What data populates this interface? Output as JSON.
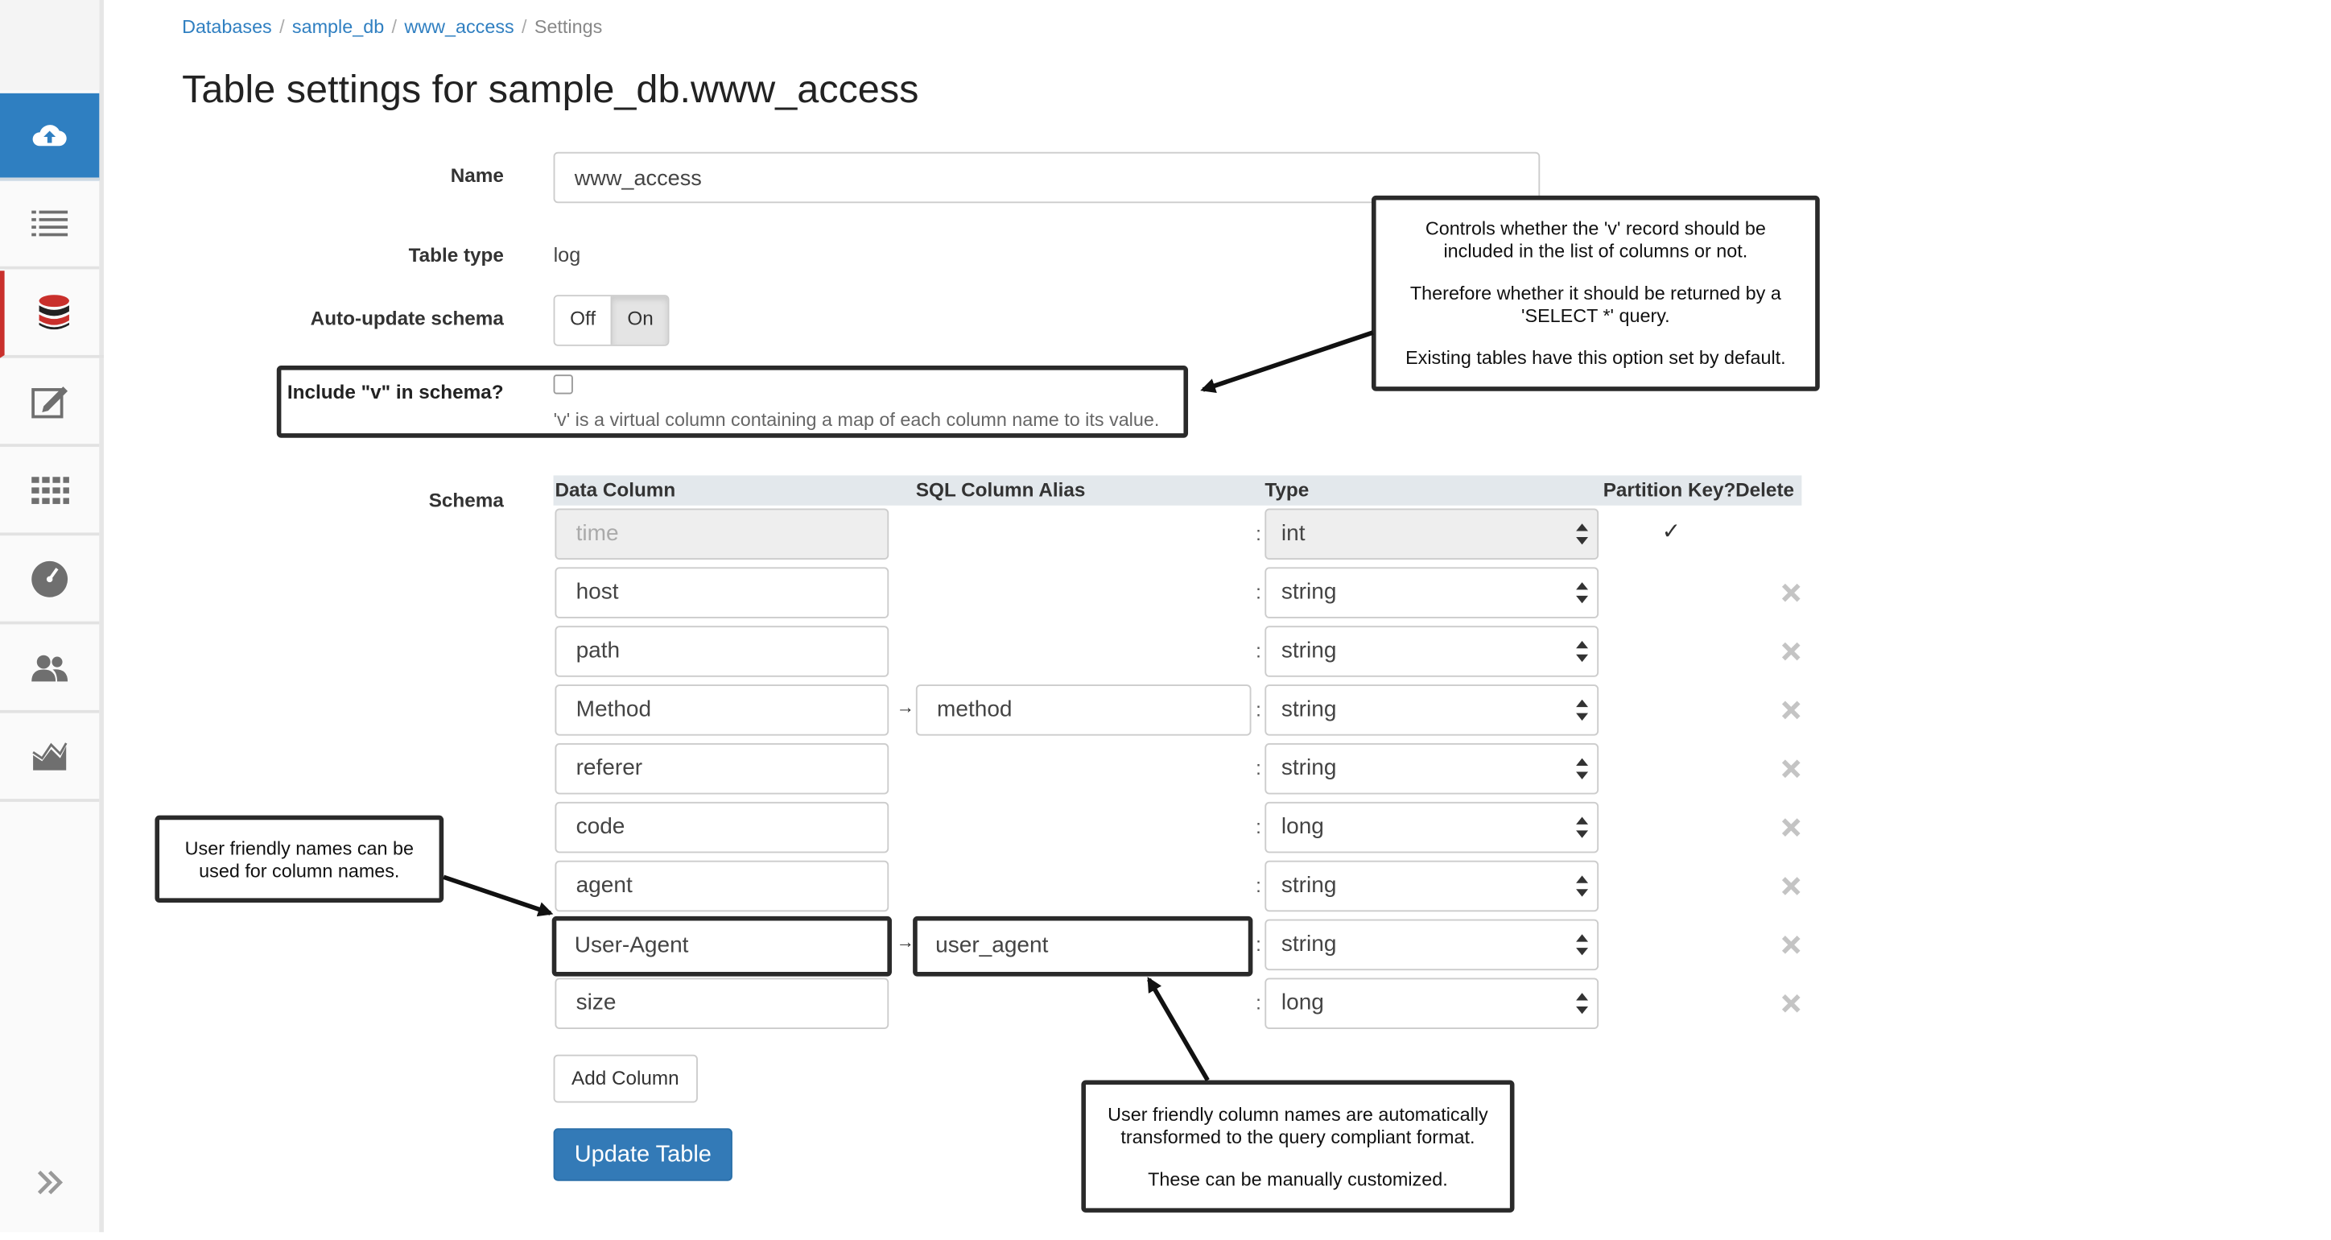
{
  "breadcrumb": {
    "items": [
      "Databases",
      "sample_db",
      "www_access"
    ],
    "current": "Settings",
    "separator": "/"
  },
  "page_title": "Table settings for sample_db.www_access",
  "sidebar": {
    "items": [
      {
        "name": "upload",
        "icon": "cloud-upload-icon"
      },
      {
        "name": "list",
        "icon": "list-icon"
      },
      {
        "name": "databases",
        "icon": "database-icon"
      },
      {
        "name": "query",
        "icon": "edit-icon"
      },
      {
        "name": "grid",
        "icon": "grid-icon"
      },
      {
        "name": "dashboard",
        "icon": "gauge-icon"
      },
      {
        "name": "users",
        "icon": "users-icon"
      },
      {
        "name": "charts",
        "icon": "area-chart-icon"
      }
    ],
    "expand_icon": "double-chevron-right-icon"
  },
  "form": {
    "name_label": "Name",
    "name_value": "www_access",
    "table_type_label": "Table type",
    "table_type_value": "log",
    "auto_update_label": "Auto-update schema",
    "toggle_off": "Off",
    "toggle_on": "On",
    "toggle_selected": "On",
    "include_v_label": "Include \"v\" in schema?",
    "include_v_checked": false,
    "include_v_help": "'v' is a virtual column containing a map of each column name to its value.",
    "schema_label": "Schema"
  },
  "schema": {
    "headers": {
      "data_column": "Data Column",
      "sql_alias": "SQL Column Alias",
      "type": "Type",
      "partition_key": "Partition Key?",
      "delete": "Delete"
    },
    "rows": [
      {
        "column": "time",
        "alias": "",
        "type": "int",
        "partition": true,
        "disabled": true
      },
      {
        "column": "host",
        "alias": "",
        "type": "string",
        "partition": false,
        "disabled": false
      },
      {
        "column": "path",
        "alias": "",
        "type": "string",
        "partition": false,
        "disabled": false
      },
      {
        "column": "Method",
        "alias": "method",
        "type": "string",
        "partition": false,
        "disabled": false
      },
      {
        "column": "referer",
        "alias": "",
        "type": "string",
        "partition": false,
        "disabled": false
      },
      {
        "column": "code",
        "alias": "",
        "type": "long",
        "partition": false,
        "disabled": false
      },
      {
        "column": "agent",
        "alias": "",
        "type": "string",
        "partition": false,
        "disabled": false
      },
      {
        "column": "User-Agent",
        "alias": "user_agent",
        "type": "string",
        "partition": false,
        "disabled": false,
        "highlighted": true
      },
      {
        "column": "size",
        "alias": "",
        "type": "long",
        "partition": false,
        "disabled": false
      }
    ],
    "colon": ":",
    "arrow": "→",
    "checkmark": "✓"
  },
  "buttons": {
    "add_column": "Add Column",
    "update_table": "Update Table"
  },
  "callouts": {
    "include_v": {
      "p1": "Controls whether the 'v' record should be included in the list of columns or not.",
      "p2": "Therefore whether it should be returned by a 'SELECT *' query.",
      "p3": "Existing tables have this option set by default."
    },
    "friendly_names": {
      "p1": "User friendly names can be used for column names."
    },
    "transform": {
      "p1": "User friendly column names are automatically transformed to the query compliant format.",
      "p2": "These can be manually customized."
    }
  },
  "colors": {
    "brand_blue": "#337ab7",
    "sidebar_active": "#2f7fc1",
    "current_marker": "#c9302c",
    "database_icon": "#c9302c"
  }
}
